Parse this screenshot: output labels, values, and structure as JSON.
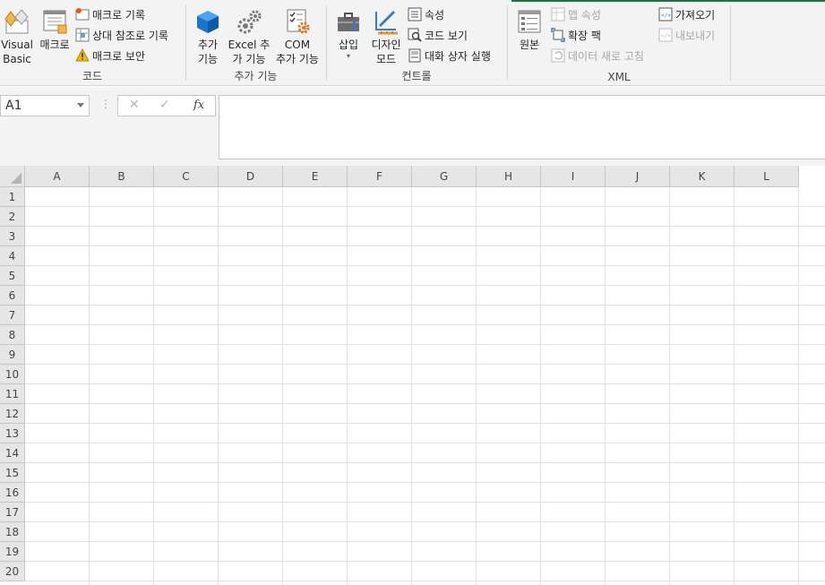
{
  "ribbon": {
    "code_group": {
      "label": "코드",
      "visual_basic": [
        "Visual",
        "Basic"
      ],
      "macros": "매크로",
      "record_macro": "매크로 기록",
      "relative_ref": "상대 참조로 기록",
      "macro_security": "매크로 보안"
    },
    "addins_group": {
      "label": "추가 기능",
      "addins": [
        "추가",
        "기능"
      ],
      "excel_addins": [
        "Excel 추",
        "가 기능"
      ],
      "com_addins": [
        "COM",
        "추가 기능"
      ]
    },
    "controls_group": {
      "label": "컨트롤",
      "insert": "삽입",
      "design_mode": [
        "디자인",
        "모드"
      ],
      "properties": "속성",
      "view_code": "코드 보기",
      "run_dialog": "대화 상자 실행"
    },
    "xml_group": {
      "label": "XML",
      "source": "원본",
      "map_properties": "맵 속성",
      "expansion_packs": "확장 팩",
      "refresh_data": "데이터 새로 고침",
      "import": "가져오기",
      "export": "내보내기"
    }
  },
  "formula_bar": {
    "name_box": "A1",
    "fx": "fx",
    "value": ""
  },
  "grid": {
    "columns": [
      "A",
      "B",
      "C",
      "D",
      "E",
      "F",
      "G",
      "H",
      "I",
      "J",
      "K",
      "L"
    ],
    "rows": [
      "1",
      "2",
      "3",
      "4",
      "5",
      "6",
      "7",
      "8",
      "9",
      "10",
      "11",
      "12",
      "13",
      "14",
      "15",
      "16",
      "17",
      "18",
      "19",
      "20"
    ]
  }
}
